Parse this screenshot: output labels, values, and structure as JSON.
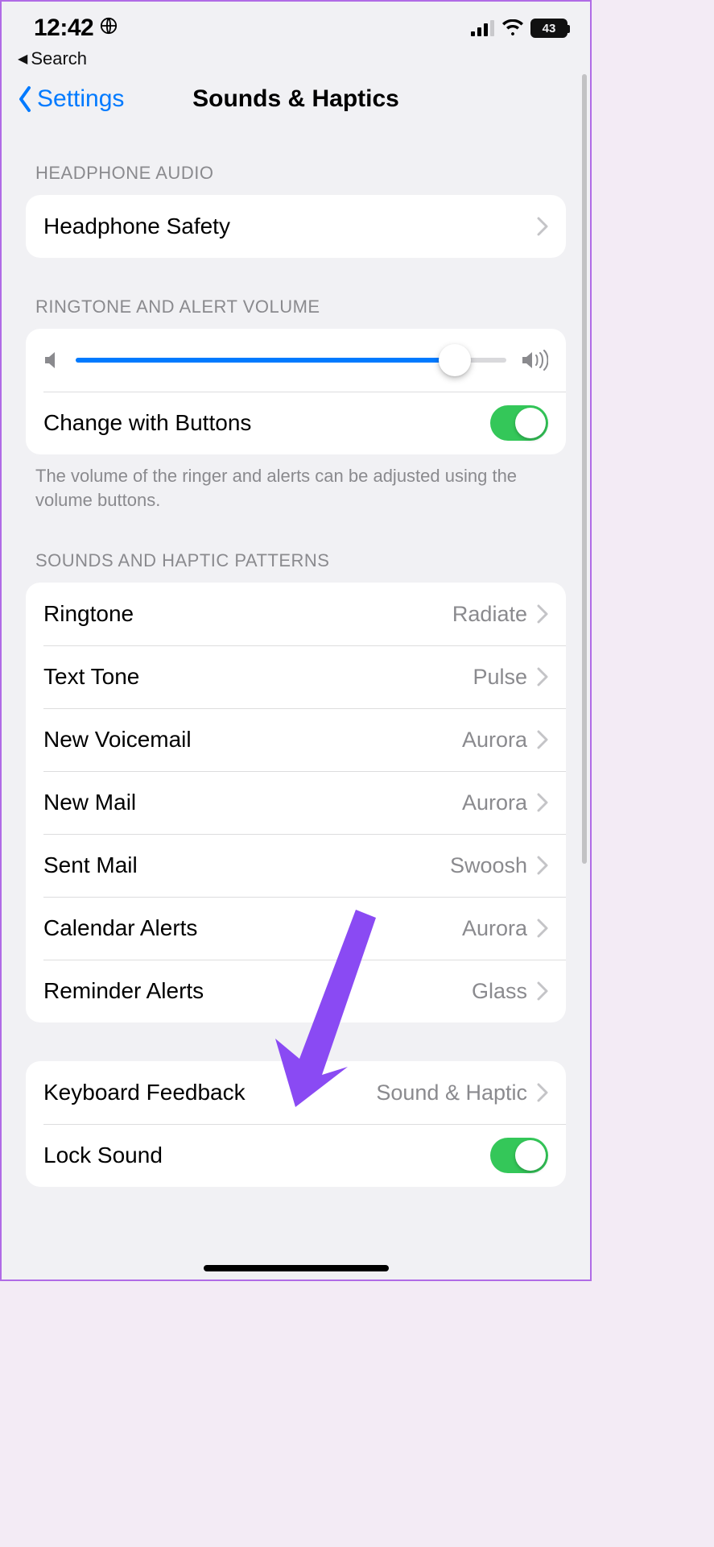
{
  "status": {
    "time": "12:42",
    "battery_text": "43"
  },
  "back_app": {
    "label": "Search"
  },
  "nav": {
    "back_label": "Settings",
    "title": "Sounds & Haptics"
  },
  "sections": {
    "headphone": {
      "header": "HEADPHONE AUDIO",
      "rows": [
        {
          "label": "Headphone Safety"
        }
      ]
    },
    "volume": {
      "header": "RINGTONE AND ALERT VOLUME",
      "slider_percent": 88,
      "change_with_buttons": {
        "label": "Change with Buttons",
        "on": true
      },
      "footer": "The volume of the ringer and alerts can be adjusted using the volume buttons."
    },
    "patterns": {
      "header": "SOUNDS AND HAPTIC PATTERNS",
      "rows": [
        {
          "label": "Ringtone",
          "value": "Radiate"
        },
        {
          "label": "Text Tone",
          "value": "Pulse"
        },
        {
          "label": "New Voicemail",
          "value": "Aurora"
        },
        {
          "label": "New Mail",
          "value": "Aurora"
        },
        {
          "label": "Sent Mail",
          "value": "Swoosh"
        },
        {
          "label": "Calendar Alerts",
          "value": "Aurora"
        },
        {
          "label": "Reminder Alerts",
          "value": "Glass"
        }
      ]
    },
    "misc": {
      "keyboard_feedback": {
        "label": "Keyboard Feedback",
        "value": "Sound & Haptic"
      },
      "lock_sound": {
        "label": "Lock Sound",
        "on": true
      }
    }
  },
  "annotation": {
    "arrow_color": "#8a4af3"
  }
}
